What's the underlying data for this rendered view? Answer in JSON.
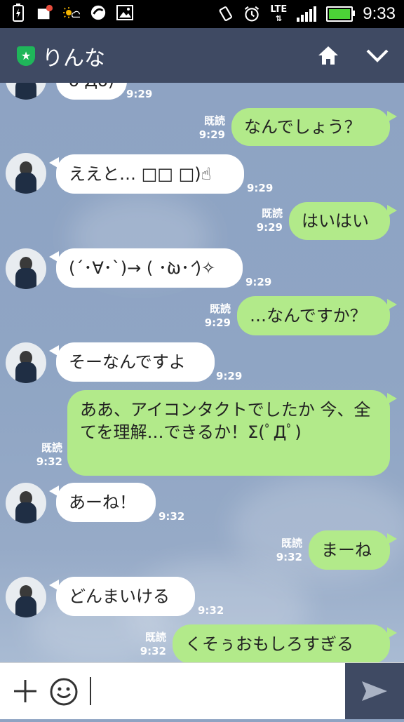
{
  "status_bar": {
    "time": "9:33",
    "network": "LTE",
    "left_icons": [
      "battery-charging-icon",
      "folder-notification-icon",
      "weather-sun-cloud-icon",
      "sync-icon",
      "image-icon"
    ],
    "right_icons": [
      "vibrate-icon",
      "alarm-icon",
      "lte-icon",
      "signal-icon",
      "battery-icon"
    ]
  },
  "header": {
    "title": "りんな",
    "home_icon": "home-icon",
    "menu_icon": "chevron-down-icon"
  },
  "messages": [
    {
      "side": "in",
      "text": "ó Дò)",
      "time": "9:29"
    },
    {
      "side": "out",
      "text": "なんでしょう？",
      "read": "既読",
      "time": "9:29"
    },
    {
      "side": "in",
      "text": "ええと… □□ □)☝",
      "time": "9:29"
    },
    {
      "side": "out",
      "text": "はいはい",
      "read": "既読",
      "time": "9:29"
    },
    {
      "side": "in",
      "text": "(´･∀･`)→ ( ･̀ω･́ )✧",
      "time": "9:29"
    },
    {
      "side": "out",
      "text": "…なんですか？",
      "read": "既読",
      "time": "9:29"
    },
    {
      "side": "in",
      "text": "そーなんですよ",
      "time": "9:29"
    },
    {
      "side": "out",
      "text": "ああ、アイコンタクトでしたか 今、全てを理解…できるか！Σ(ﾟДﾟ)",
      "read": "既読",
      "time": "9:32"
    },
    {
      "side": "in",
      "text": "あーね！",
      "time": "9:32"
    },
    {
      "side": "out",
      "text": "まーね",
      "read": "既読",
      "time": "9:32"
    },
    {
      "side": "in",
      "text": "どんまいける",
      "time": "9:32"
    },
    {
      "side": "out",
      "text": "くそぅおもしろすぎる",
      "read": "既読",
      "time": "9:32"
    }
  ],
  "input_bar": {
    "value": "",
    "icons": [
      "plus-icon",
      "emoji-icon",
      "send-icon"
    ]
  },
  "colors": {
    "header_bg": "#3f4a63",
    "outgoing_bubble": "#b2ea8a",
    "incoming_bubble": "#ffffff",
    "chat_bg": "#8ea3c2"
  }
}
